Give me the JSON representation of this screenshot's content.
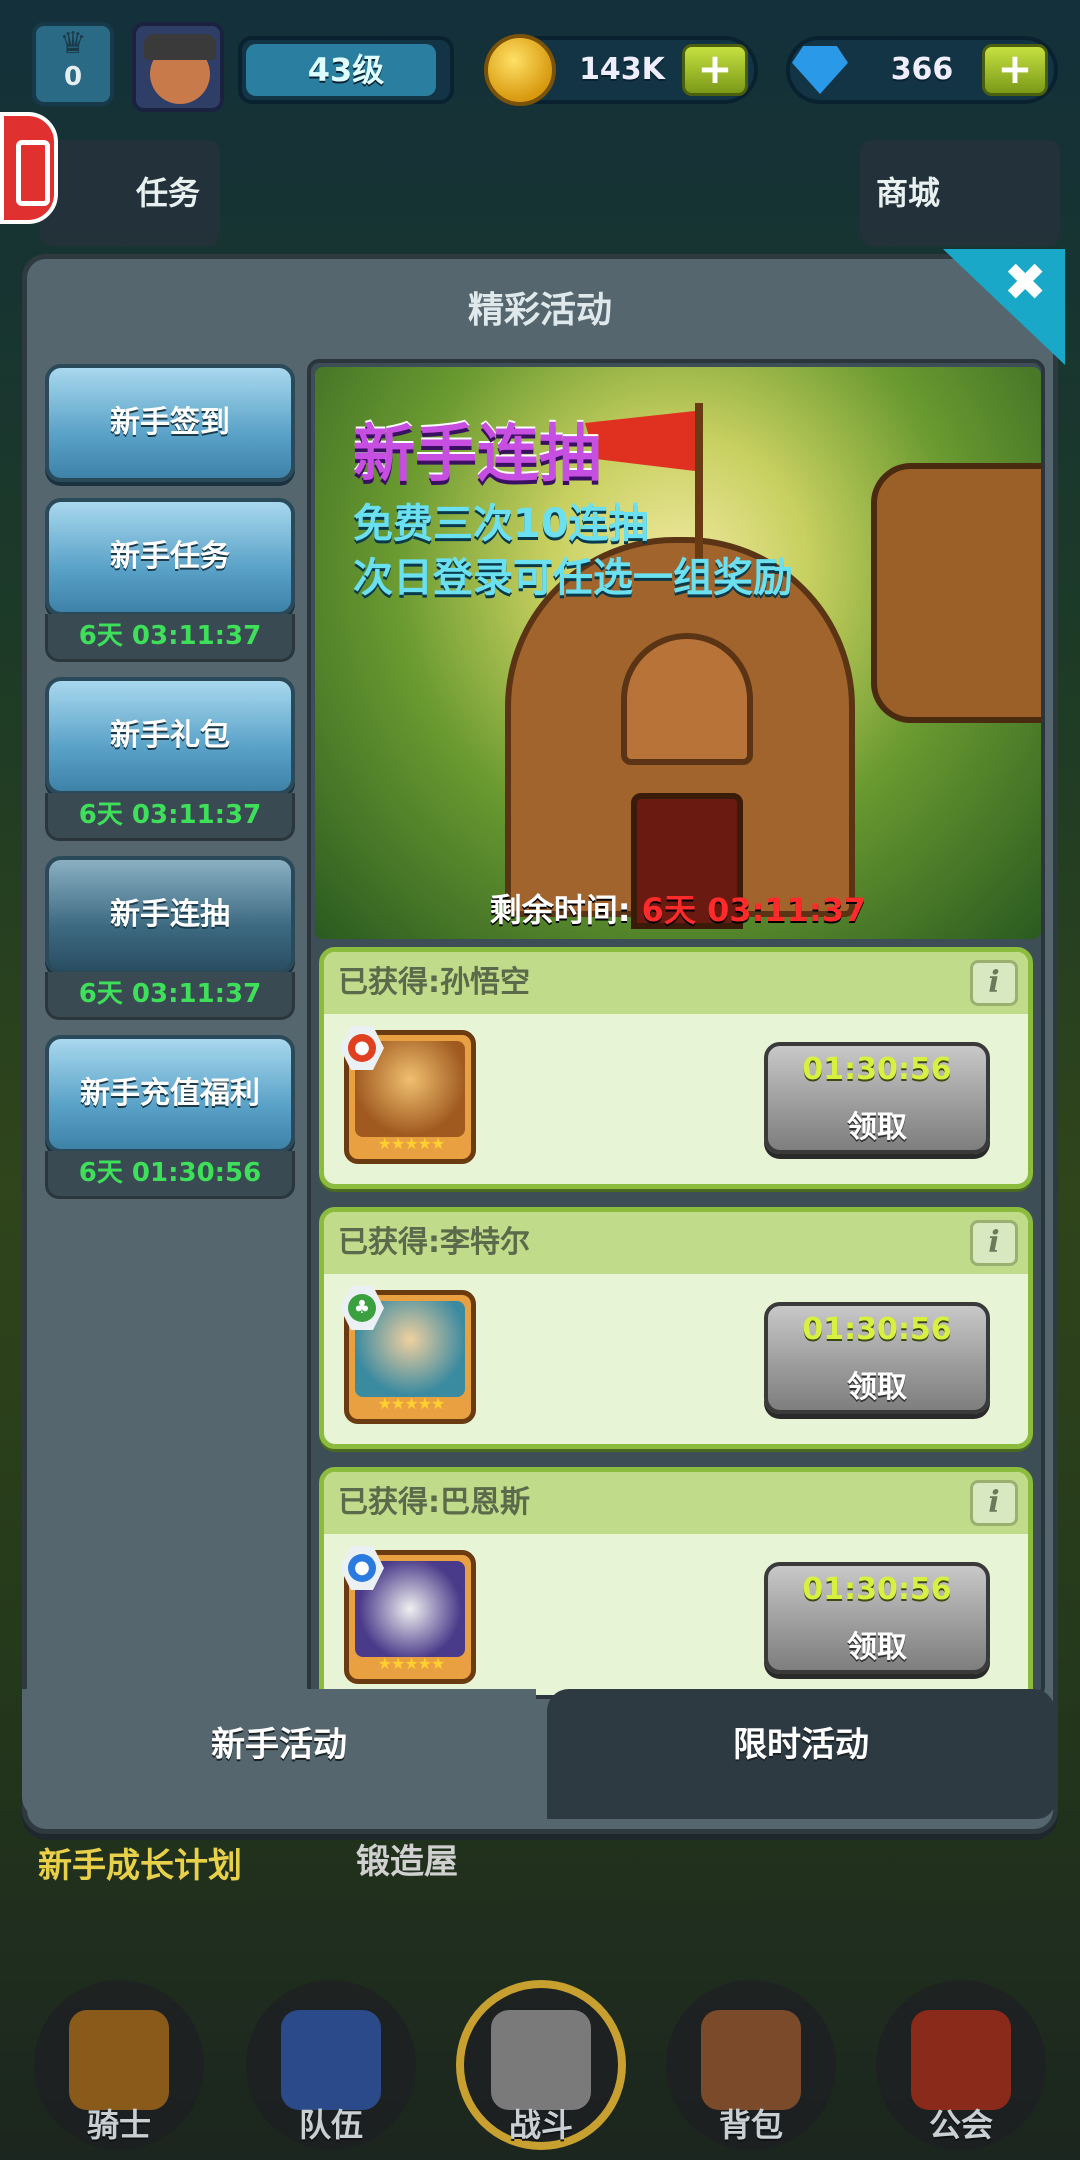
{
  "topbar": {
    "rank": "0",
    "level": "43级",
    "gold": "143K",
    "gems": "366",
    "plus": "+"
  },
  "side_buttons": {
    "tasks": "任务",
    "shop": "商城"
  },
  "modal": {
    "title": "精彩活动",
    "close": "✖"
  },
  "side_tabs": [
    {
      "label": "新手签到",
      "timer": ""
    },
    {
      "label": "新手任务",
      "timer": "6天 03:11:37"
    },
    {
      "label": "新手礼包",
      "timer": "6天 03:11:37"
    },
    {
      "label": "新手连抽",
      "timer": "6天 03:11:37"
    },
    {
      "label": "新手充值福利",
      "timer": "6天 01:30:56"
    }
  ],
  "banner": {
    "title": "新手连抽",
    "line1": "免费三次10连抽",
    "line2": "次日登录可任选一组奖励",
    "remain_label": "剩余时间:",
    "remain_value": "6天 03:11:37"
  },
  "rewards": [
    {
      "title": "已获得:孙悟空",
      "timer": "01:30:56",
      "claim": "领取",
      "element": "fire",
      "stars": "★★★★★",
      "color": "#e04020"
    },
    {
      "title": "已获得:李特尔",
      "timer": "01:30:56",
      "claim": "领取",
      "element": "leaf",
      "stars": "★★★★★",
      "color": "#3aa040"
    },
    {
      "title": "已获得:巴恩斯",
      "timer": "01:30:56",
      "claim": "领取",
      "element": "water",
      "stars": "★★★★★",
      "color": "#2a7ae0"
    }
  ],
  "info_icon": "i",
  "bottom_tabs": {
    "left": "新手活动",
    "right": "限时活动"
  },
  "bg_labels": {
    "growth_plan": "新手成长计划",
    "forge": "锻造屋"
  },
  "nav": [
    "骑士",
    "队伍",
    "战斗",
    "背包",
    "公会"
  ]
}
